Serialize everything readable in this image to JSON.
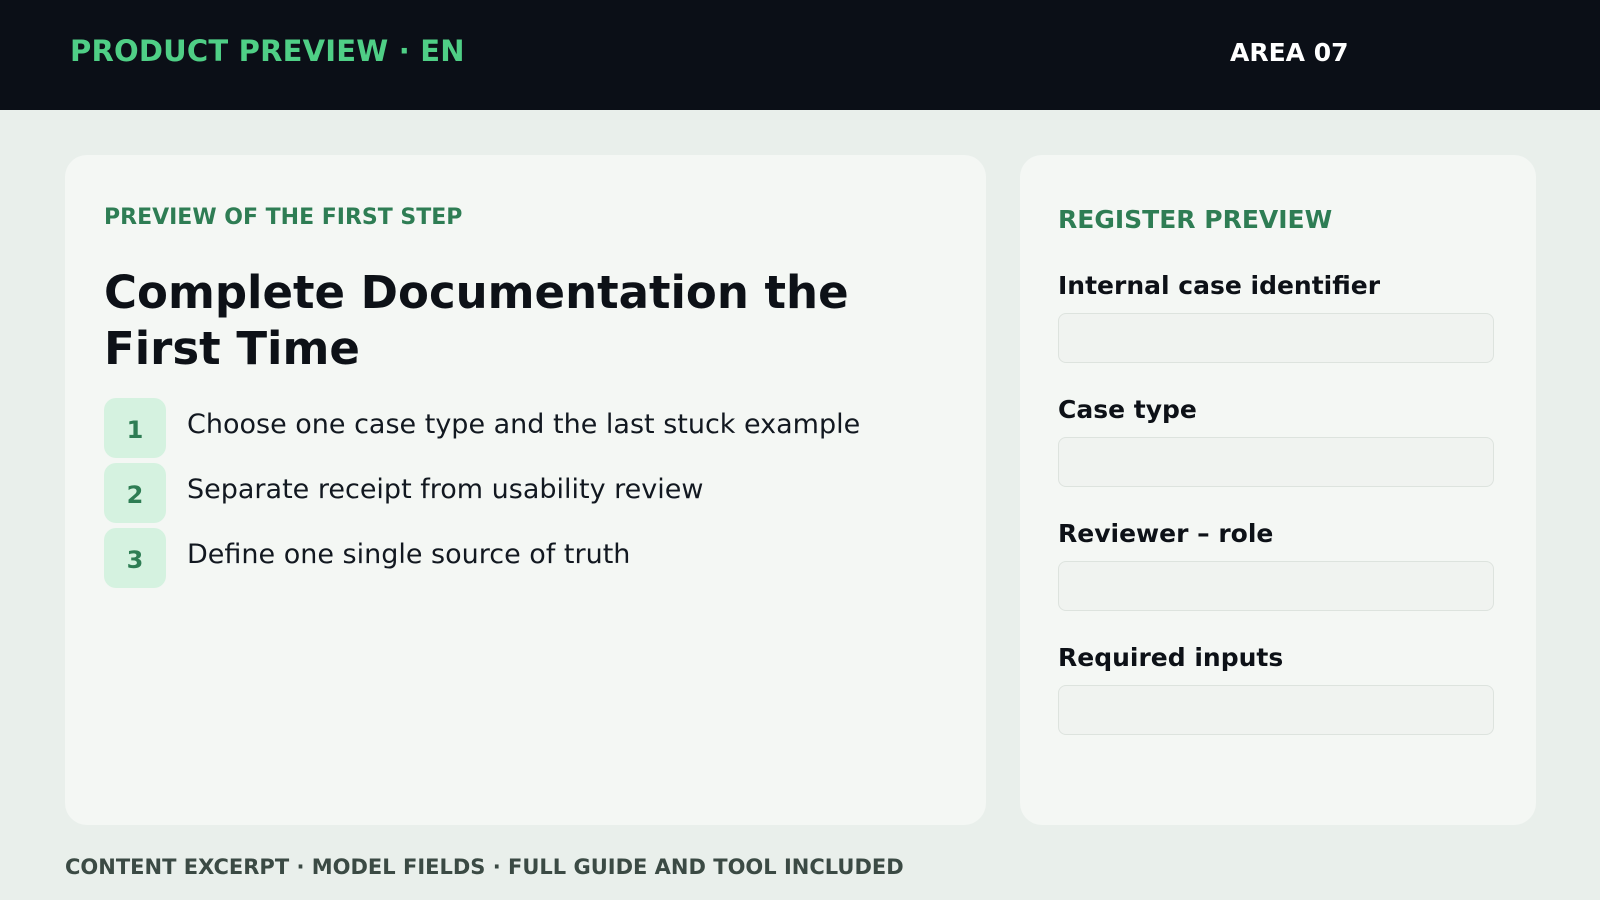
{
  "header": {
    "brand": "PRODUCT PREVIEW · EN",
    "area": "AREA 07"
  },
  "preview": {
    "eyebrow": "PREVIEW OF THE FIRST STEP",
    "title": "Complete Documentation the First Time",
    "steps": [
      {
        "number": "1",
        "text": "Choose one case type and the last stuck example"
      },
      {
        "number": "2",
        "text": "Separate receipt from usability review"
      },
      {
        "number": "3",
        "text": "Define one single source of truth"
      }
    ]
  },
  "register": {
    "title": "REGISTER PREVIEW",
    "fields": [
      {
        "label": "Internal case identifier",
        "value": ""
      },
      {
        "label": "Case type",
        "value": ""
      },
      {
        "label": "Reviewer – role",
        "value": ""
      },
      {
        "label": "Required inputs",
        "value": ""
      }
    ]
  },
  "footer": {
    "text": "CONTENT EXCERPT · MODEL FIELDS · FULL GUIDE AND TOOL INCLUDED"
  },
  "colors": {
    "topbar": "#0b0f17",
    "brand": "#4fcf86",
    "accent": "#2e7d54",
    "background": "#e9efeb",
    "card": "#f4f7f4",
    "step_badge": "#d5f2e0"
  }
}
